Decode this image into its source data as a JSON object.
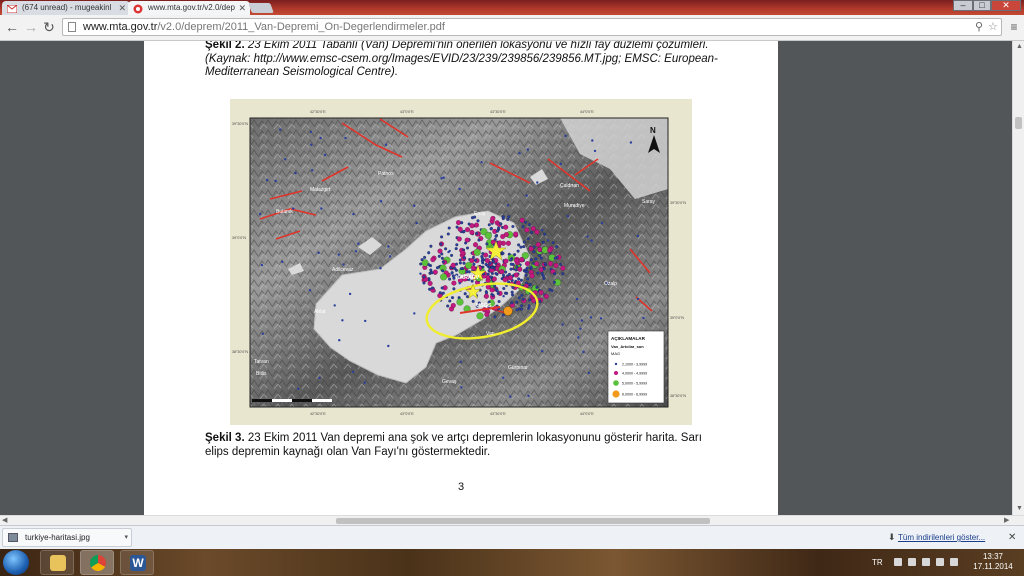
{
  "browser": {
    "tabs": [
      {
        "title": "(674 unread) - mugeakinl",
        "active": false
      },
      {
        "title": "www.mta.gov.tr/v2.0/dep",
        "active": true
      }
    ],
    "window_controls": {
      "minimize": "–",
      "maximize": "□",
      "close": "✕"
    },
    "url_host": "www.mta.gov.tr",
    "url_path": "/v2.0/deprem/2011_Van-Depremi_On-Degerlendirmeler.pdf"
  },
  "document": {
    "caption_2_label": "Şekil 2.",
    "caption_2_text": " 23 Ekim 2011 Tabanlı (Van) Depremi'nin önerilen lokasyonu ve hızlı fay düzlemi çözümleri. (Kaynak:  http://www.emsc-csem.org/Images/EVID/23/239/239856/239856.MT.jpg;  EMSC: European-Mediterranean Seismological Centre).",
    "caption_3_label": "Şekil 3.",
    "caption_3_text": " 23 Ekim 2011 Van depremi ana şok ve artçı depremlerin lokasyonunu gösterir harita. Sarı elips depremin kaynağı olan Van Fayı'nı göstermektedir.",
    "page_number": "3"
  },
  "map": {
    "north_label": "N",
    "places": [
      "Patnos",
      "Malazgirt",
      "Bulanık",
      "Erciş",
      "Çaldıran",
      "Muradiye",
      "Özalp",
      "Ahlat",
      "Adilcevaz",
      "Tatvan",
      "Van",
      "Gürpınar",
      "Gevaş",
      "Bitlis",
      "Saray"
    ],
    "map_labels": [
      "KARAEV",
      "USGS"
    ],
    "legend": {
      "title": "AÇIKLAMALAR",
      "subtitle": "Van_Artcilar_son",
      "field": "MAG",
      "classes": [
        {
          "label": "2,1000 - 3,9999",
          "color": "#2b3f9e"
        },
        {
          "label": "4,0000 - 4,9999",
          "color": "#c2187f"
        },
        {
          "label": "5,0000 - 5,9999",
          "color": "#5cc13a"
        },
        {
          "label": "6,0000 - 6,9999",
          "color": "#f29a1b"
        }
      ]
    },
    "top_ticks": [
      "42°30'0\"E",
      "43°0'0\"E",
      "43°30'0\"E",
      "44°0'0\"E"
    ],
    "bottom_ticks": [
      "42°30'0\"E",
      "43°0'0\"E",
      "43°30'0\"E",
      "44°0'0\"E"
    ],
    "left_ticks": [
      "39°30'0\"N",
      "39°0'0\"N",
      "38°30'0\"N"
    ],
    "right_ticks": [
      "39°30'0\"N",
      "39°0'0\"N",
      "38°30'0\"N"
    ]
  },
  "downloads": {
    "file_name": "turkiye-haritasi.jpg",
    "show_all": "Tüm indirilenleri göster..."
  },
  "taskbar": {
    "language": "TR",
    "time": "13:37",
    "date": "17.11.2014"
  },
  "colors": {
    "tab_strip": "#b23a2c",
    "ellipse": "#f0ec2e",
    "fault_lines": "#e0342a"
  }
}
